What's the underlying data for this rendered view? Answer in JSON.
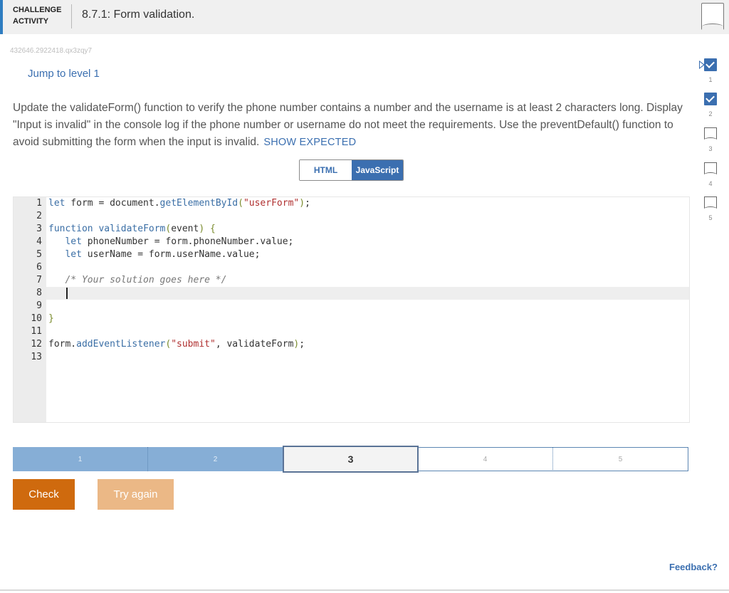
{
  "header": {
    "badge_line1": "CHALLENGE",
    "badge_line2": "ACTIVITY",
    "title": "8.7.1: Form validation."
  },
  "meta_id": "432646.2922418.qx3zqy7",
  "jump_link": "Jump to level 1",
  "description": "Update the validateForm() function to verify the phone number contains a number and the username is at least 2 characters long. Display \"Input is invalid\" in the console log if the phone number or username do not meet the requirements. Use the preventDefault() function to avoid submitting the form when the input is invalid.",
  "show_expected": "SHOW EXPECTED",
  "lang_tabs": {
    "html": "HTML",
    "js": "JavaScript",
    "selected": "JavaScript"
  },
  "code_lines": [
    "let form = document.getElementById(\"userForm\");",
    "",
    "function validateForm(event) {",
    "   let phoneNumber = form.phoneNumber.value;",
    "   let userName = form.userName.value;",
    "",
    "   /* Your solution goes here */",
    "",
    "",
    "}",
    "",
    "form.addEventListener(\"submit\", validateForm);",
    ""
  ],
  "levels": {
    "labels": [
      "1",
      "2",
      "3",
      "4",
      "5"
    ],
    "current": 3,
    "completed": 2
  },
  "buttons": {
    "check": "Check",
    "try_again": "Try again"
  },
  "feedback": "Feedback?",
  "side_levels": [
    {
      "num": "1",
      "status": "done"
    },
    {
      "num": "2",
      "status": "done"
    },
    {
      "num": "3",
      "status": "todo"
    },
    {
      "num": "4",
      "status": "todo"
    },
    {
      "num": "5",
      "status": "todo"
    }
  ],
  "colors": {
    "accent": "#3b6fb0",
    "check_button": "#cf6a0e",
    "try_again_button": "#ebb886",
    "level_done": "#86aed6"
  },
  "icons": {
    "bookmark": "bookmark-icon",
    "check": "checkmark-icon",
    "arrow": "current-level-arrow-icon"
  }
}
